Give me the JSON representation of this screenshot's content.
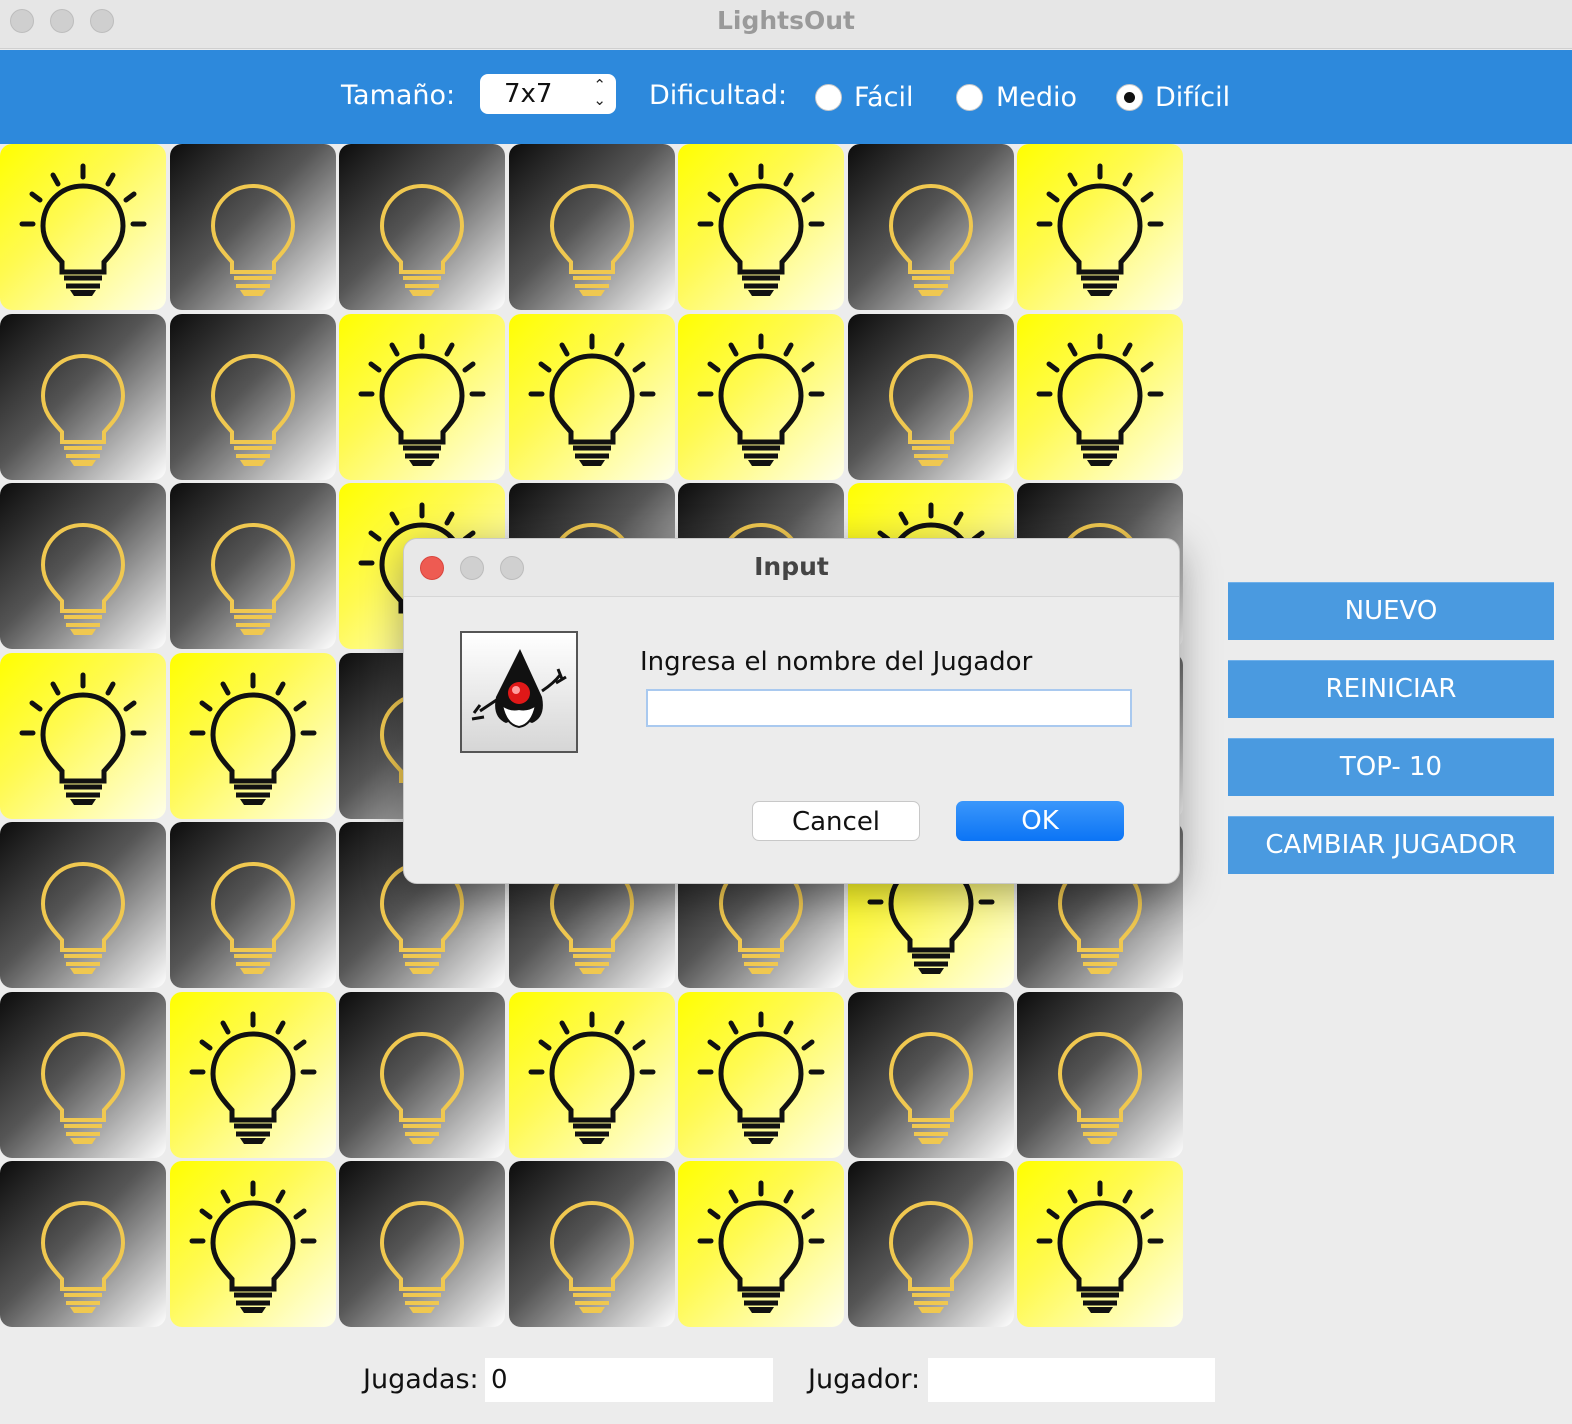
{
  "window": {
    "title": "LightsOut"
  },
  "toolbar": {
    "size_label": "Tamaño:",
    "size_value": "7x7",
    "difficulty_label": "Dificultad:",
    "difficulty_options": [
      "Fácil",
      "Medio",
      "Difícil"
    ],
    "difficulty_selected": "Difícil"
  },
  "board": {
    "rows": 7,
    "cols": 7,
    "state": [
      [
        1,
        0,
        0,
        0,
        1,
        0,
        1
      ],
      [
        0,
        0,
        1,
        1,
        1,
        0,
        1
      ],
      [
        0,
        0,
        1,
        0,
        0,
        1,
        0
      ],
      [
        1,
        1,
        0,
        0,
        0,
        0,
        0
      ],
      [
        0,
        0,
        0,
        0,
        0,
        1,
        0
      ],
      [
        0,
        1,
        0,
        1,
        1,
        0,
        0
      ],
      [
        0,
        1,
        0,
        0,
        1,
        0,
        1
      ]
    ],
    "icons": {
      "on": "lightbulb-on-icon",
      "off": "lightbulb-off-icon"
    },
    "colors": {
      "on": "#ffff00",
      "off": "#111111",
      "bulb_off_outline": "#f0c850"
    }
  },
  "side": {
    "new_label": "NUEVO",
    "restart_label": "REINICIAR",
    "top10_label": "TOP- 10",
    "change_player_label": "CAMBIAR JUGADOR"
  },
  "footer": {
    "moves_label": "Jugadas:",
    "moves_value": "0",
    "player_label": "Jugador:",
    "player_value": ""
  },
  "dialog": {
    "title": "Input",
    "icon": "java-duke-icon",
    "message": "Ingresa el nombre del Jugador",
    "input_value": "",
    "cancel_label": "Cancel",
    "ok_label": "OK"
  },
  "colors": {
    "toolbar": "#2d89dc",
    "side_button": "#4a9ae0",
    "ok_button": "#0b74f5"
  }
}
